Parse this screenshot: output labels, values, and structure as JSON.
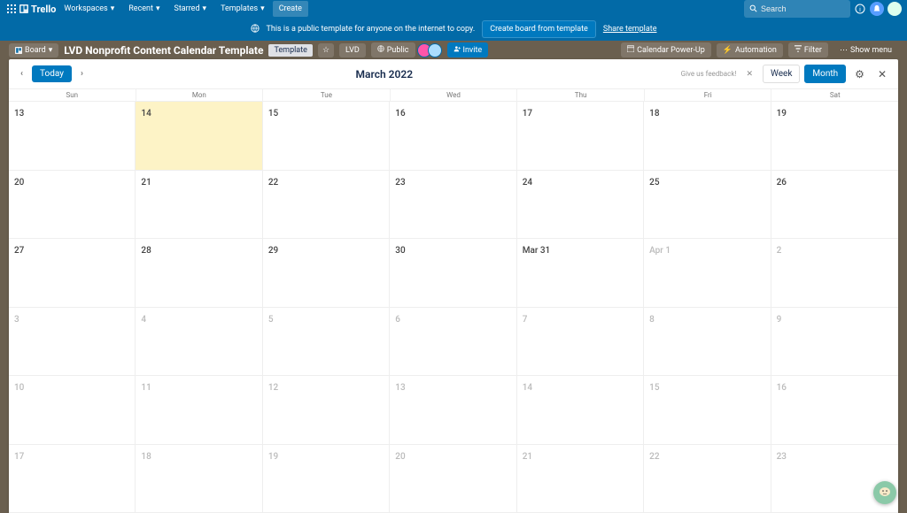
{
  "colors": {
    "brand": "#026aa7",
    "accent": "#0079bf"
  },
  "topbar": {
    "logo": "Trello",
    "nav": {
      "workspaces": "Workspaces",
      "recent": "Recent",
      "starred": "Starred",
      "templates": "Templates"
    },
    "create": "Create",
    "search_placeholder": "Search"
  },
  "banner": {
    "text": "This is a public template for anyone on the internet to copy.",
    "create_btn": "Create board from template",
    "share_link": "Share template"
  },
  "board_header": {
    "view": "Board",
    "title": "LVD Nonprofit Content Calendar Template",
    "template_tag": "Template",
    "org": "LVD",
    "public": "Public",
    "invite": "Invite",
    "powerup": "Calendar Power-Up",
    "automation": "Automation",
    "filter": "Filter",
    "show_menu": "Show menu"
  },
  "calendar": {
    "today": "Today",
    "title": "March 2022",
    "feedback": "Give us feedback!",
    "view_week": "Week",
    "view_month": "Month",
    "dow": [
      "Sun",
      "Mon",
      "Tue",
      "Wed",
      "Thu",
      "Fri",
      "Sat"
    ],
    "cells": [
      {
        "label": "13",
        "muted": false,
        "today": false
      },
      {
        "label": "14",
        "muted": false,
        "today": true
      },
      {
        "label": "15",
        "muted": false,
        "today": false
      },
      {
        "label": "16",
        "muted": false,
        "today": false
      },
      {
        "label": "17",
        "muted": false,
        "today": false
      },
      {
        "label": "18",
        "muted": false,
        "today": false
      },
      {
        "label": "19",
        "muted": false,
        "today": false
      },
      {
        "label": "20",
        "muted": false,
        "today": false
      },
      {
        "label": "21",
        "muted": false,
        "today": false
      },
      {
        "label": "22",
        "muted": false,
        "today": false
      },
      {
        "label": "23",
        "muted": false,
        "today": false
      },
      {
        "label": "24",
        "muted": false,
        "today": false
      },
      {
        "label": "25",
        "muted": false,
        "today": false
      },
      {
        "label": "26",
        "muted": false,
        "today": false
      },
      {
        "label": "27",
        "muted": false,
        "today": false
      },
      {
        "label": "28",
        "muted": false,
        "today": false
      },
      {
        "label": "29",
        "muted": false,
        "today": false
      },
      {
        "label": "30",
        "muted": false,
        "today": false
      },
      {
        "label": "Mar 31",
        "muted": false,
        "today": false
      },
      {
        "label": "Apr 1",
        "muted": true,
        "today": false
      },
      {
        "label": "2",
        "muted": true,
        "today": false
      },
      {
        "label": "3",
        "muted": true,
        "today": false
      },
      {
        "label": "4",
        "muted": true,
        "today": false
      },
      {
        "label": "5",
        "muted": true,
        "today": false
      },
      {
        "label": "6",
        "muted": true,
        "today": false
      },
      {
        "label": "7",
        "muted": true,
        "today": false
      },
      {
        "label": "8",
        "muted": true,
        "today": false
      },
      {
        "label": "9",
        "muted": true,
        "today": false
      },
      {
        "label": "10",
        "muted": true,
        "today": false
      },
      {
        "label": "11",
        "muted": true,
        "today": false
      },
      {
        "label": "12",
        "muted": true,
        "today": false
      },
      {
        "label": "13",
        "muted": true,
        "today": false
      },
      {
        "label": "14",
        "muted": true,
        "today": false
      },
      {
        "label": "15",
        "muted": true,
        "today": false
      },
      {
        "label": "16",
        "muted": true,
        "today": false
      },
      {
        "label": "17",
        "muted": true,
        "today": false
      },
      {
        "label": "18",
        "muted": true,
        "today": false
      },
      {
        "label": "19",
        "muted": true,
        "today": false
      },
      {
        "label": "20",
        "muted": true,
        "today": false
      },
      {
        "label": "21",
        "muted": true,
        "today": false
      },
      {
        "label": "22",
        "muted": true,
        "today": false
      },
      {
        "label": "23",
        "muted": true,
        "today": false
      }
    ]
  }
}
